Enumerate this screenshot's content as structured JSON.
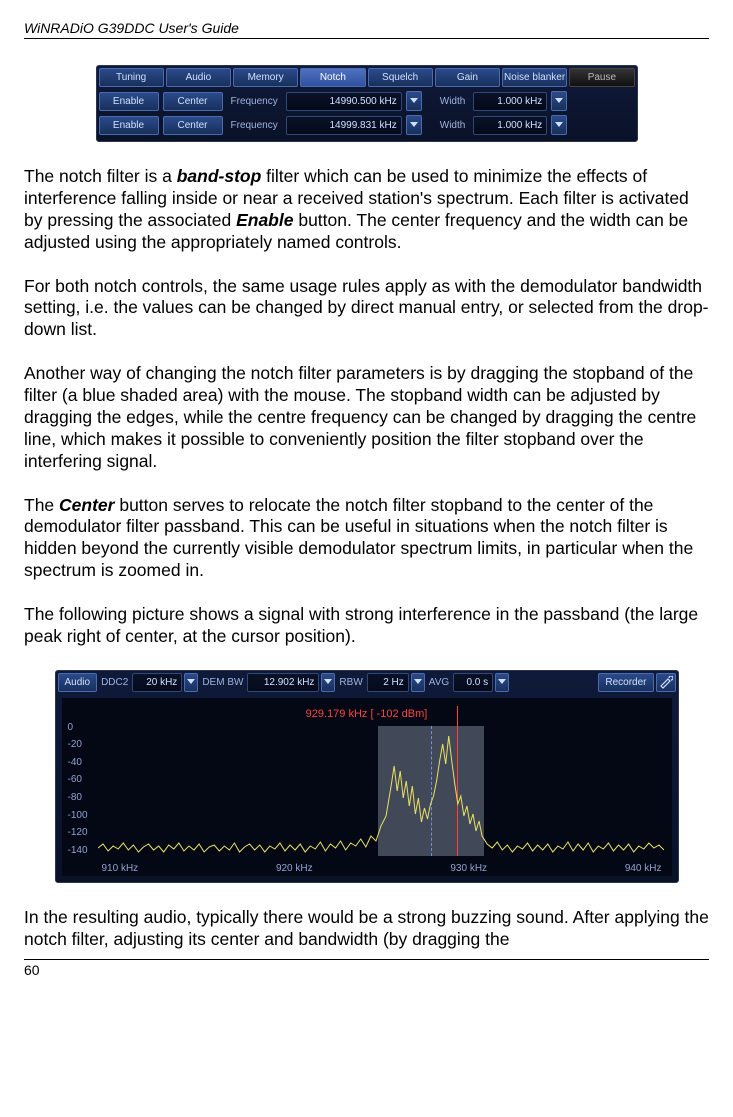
{
  "header": {
    "title": "WiNRADiO G39DDC User's Guide"
  },
  "notch_panel": {
    "tabs": [
      "Tuning",
      "Audio",
      "Memory",
      "Notch",
      "Squelch",
      "Gain",
      "Noise blanker",
      "Pause"
    ],
    "active_tab_index": 3,
    "rows": [
      {
        "enable": "Enable",
        "center": "Center",
        "freq_label": "Frequency",
        "freq": "14990.500 kHz",
        "width_label": "Width",
        "width": "1.000 kHz"
      },
      {
        "enable": "Enable",
        "center": "Center",
        "freq_label": "Frequency",
        "freq": "14999.831 kHz",
        "width_label": "Width",
        "width": "1.000 kHz"
      }
    ]
  },
  "paragraphs": {
    "p1_a": "The notch filter is a ",
    "p1_b": "band-stop",
    "p1_c": " filter which can be used to minimize the effects of interference falling inside or near a received station's spectrum. Each filter is activated by pressing the associated ",
    "p1_d": "Enable",
    "p1_e": " button. The center frequency and the width can be adjusted using the appropriately named controls.",
    "p2": "For both notch controls, the same usage rules apply as with the demodulator bandwidth setting, i.e. the values can be changed by direct manual entry, or selected from the drop-down list.",
    "p3": "Another way of changing the notch filter parameters is by dragging the stopband of the filter (a blue shaded area) with the mouse.  The stopband width can be adjusted by dragging the edges, while the centre frequency can be changed by dragging the centre line, which makes it possible to conveniently position the filter stopband over the interfering signal.",
    "p4_a": "The ",
    "p4_b": "Center",
    "p4_c": " button serves to relocate the notch filter stopband to the center of the demodulator filter passband. This can be useful in situations when the notch filter is hidden beyond the currently visible demodulator spectrum limits, in particular when the spectrum is zoomed in.",
    "p5": "The following picture shows a signal with strong interference in the passband (the large peak right of center, at the cursor position).",
    "p6": "In the resulting audio, typically there would be a strong buzzing sound. After applying the notch filter, adjusting its center and bandwidth (by dragging the"
  },
  "spectrum_panel": {
    "toolbar": {
      "audio": "Audio",
      "ddc2_label": "DDC2",
      "ddc2_value": "20 kHz",
      "dembw_label": "DEM BW",
      "dembw_value": "12.902 kHz",
      "rbw_label": "RBW",
      "rbw_value": "2 Hz",
      "avg_label": "AVG",
      "avg_value": "0.0 s",
      "recorder": "Recorder"
    },
    "cursor_label": "929.179 kHz [ -102 dBm]",
    "y_ticks": [
      "0",
      "-20",
      "-40",
      "-60",
      "-80",
      "-100",
      "-120",
      "-140"
    ],
    "x_ticks": [
      "910 kHz",
      "920 kHz",
      "930 kHz",
      "940 kHz"
    ]
  },
  "footer": {
    "page": "60"
  }
}
